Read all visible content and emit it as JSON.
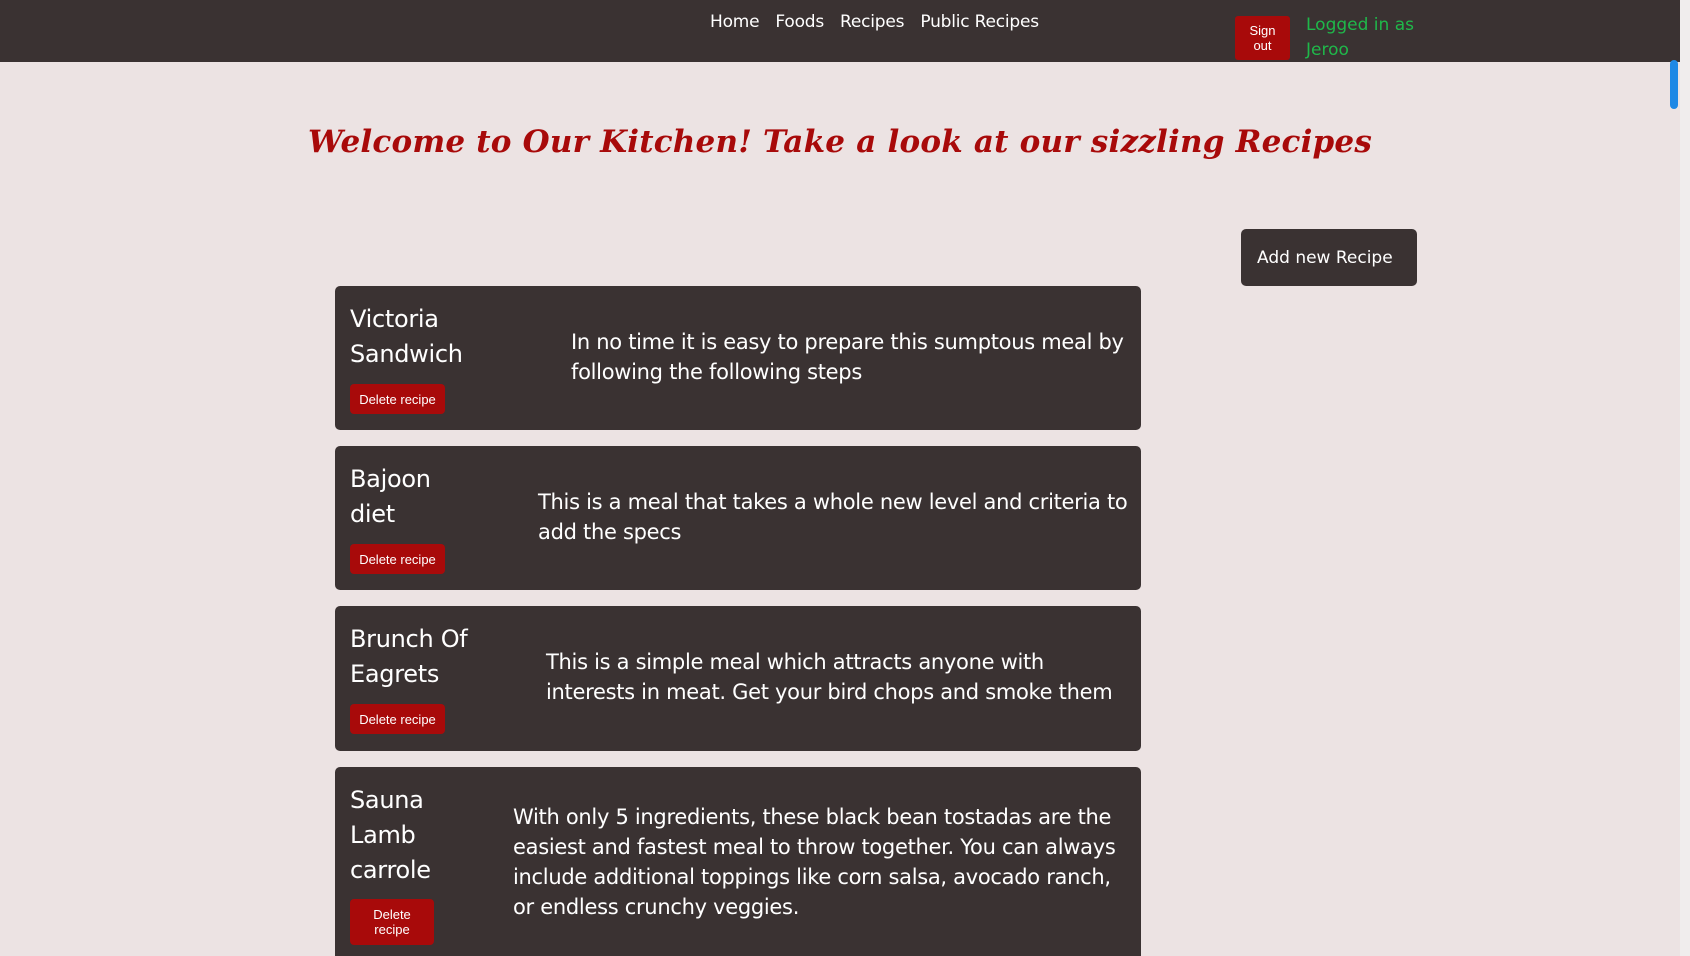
{
  "nav": {
    "links": [
      "Home",
      "Foods",
      "Recipes",
      "Public Recipes"
    ],
    "signout_label": "Sign out",
    "logged_in_text": "Logged in as Jeroo"
  },
  "welcome_text": "Welcome to Our Kitchen! Take a look at our sizzling Recipes",
  "add_recipe_label": "Add new Recipe",
  "recipes": [
    {
      "name": "Victoria Sandwich",
      "delete_label": "Delete recipe",
      "description": "In no time it is easy to prepare this sumptous meal by following the following steps"
    },
    {
      "name": "Bajoon diet",
      "delete_label": "Delete recipe",
      "description": "This is a meal that takes a whole new level and criteria to add the specs"
    },
    {
      "name": "Brunch Of Eagrets",
      "delete_label": "Delete recipe",
      "description": "This is a simple meal which attracts anyone with interests in meat. Get your bird chops and smoke them"
    },
    {
      "name": "Sauna Lamb carrole",
      "delete_label": "Delete recipe",
      "description": "With only 5 ingredients, these black bean tostadas are the easiest and fastest meal to throw together. You can always include additional toppings like corn salsa, avocado ranch, or endless crunchy veggies."
    }
  ],
  "colors": {
    "navbar_bg": "#3a3232",
    "page_bg": "#ece3e3",
    "accent_red": "#a80a0a",
    "logged_in_green": "#1fb84a"
  }
}
